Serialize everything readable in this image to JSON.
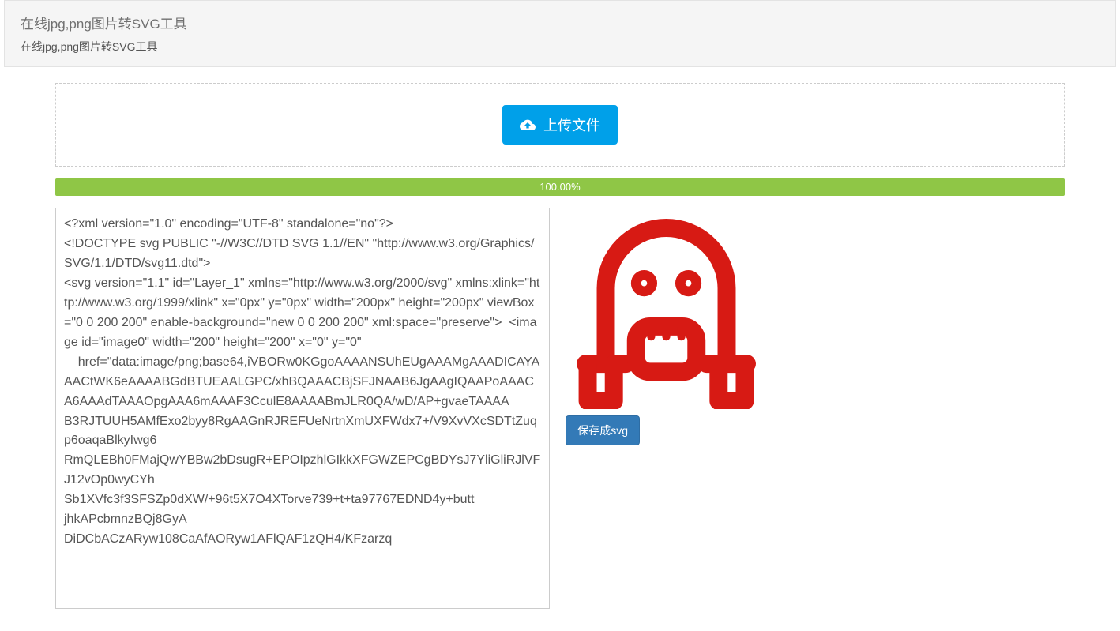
{
  "header": {
    "title": "在线jpg,png图片转SVG工具",
    "subtitle": "在线jpg,png图片转SVG工具"
  },
  "upload": {
    "button_label": "上传文件"
  },
  "progress": {
    "text": "100.00%"
  },
  "textarea": {
    "content": "<?xml version=\"1.0\" encoding=\"UTF-8\" standalone=\"no\"?>\n<!DOCTYPE svg PUBLIC \"-//W3C//DTD SVG 1.1//EN\" \"http://www.w3.org/Graphics/SVG/1.1/DTD/svg11.dtd\">\n<svg version=\"1.1\" id=\"Layer_1\" xmlns=\"http://www.w3.org/2000/svg\" xmlns:xlink=\"http://www.w3.org/1999/xlink\" x=\"0px\" y=\"0px\" width=\"200px\" height=\"200px\" viewBox=\"0 0 200 200\" enable-background=\"new 0 0 200 200\" xml:space=\"preserve\">  <image id=\"image0\" width=\"200\" height=\"200\" x=\"0\" y=\"0\"\n    href=\"data:image/png;base64,iVBORw0KGgoAAAANSUhEUgAAAMgAAADICAYAAACtWK6eAAAABGdBTUEAALGPC/xhBQAAACBjSFJNAAB6JgAAgIQAAPoAAACA6AAAdTAAAOpgAAA6mAAAF3CculE8AAAABmJLR0QA/wD/AP+gvaeTAAAA\nB3RJTUUH5AMfExo2byy8RgAAGnRJREFUeNrtnXmUXFWdx7+/V9XvVXcSDTtZuqp6oaqaBlkyIwg6\nRmQLEBh0FMajQwYBBw2bDsugR+EPOIpzhlGIkkXFGWZEPCgBDYsJ7YliGliRJlVFJ12vOp0wyCYh\nSb1XVfc3f3SFSZp0dXW/+96t5X7O4XTorve739+t+ta97767EDND4y+butt\njhkAPcbmnzBQj8GyA\nDiDCbACzARyw108CaAfAORyw1AFlQAF1zQH4/KFzarzq"
  },
  "save": {
    "button_label": "保存成svg"
  }
}
